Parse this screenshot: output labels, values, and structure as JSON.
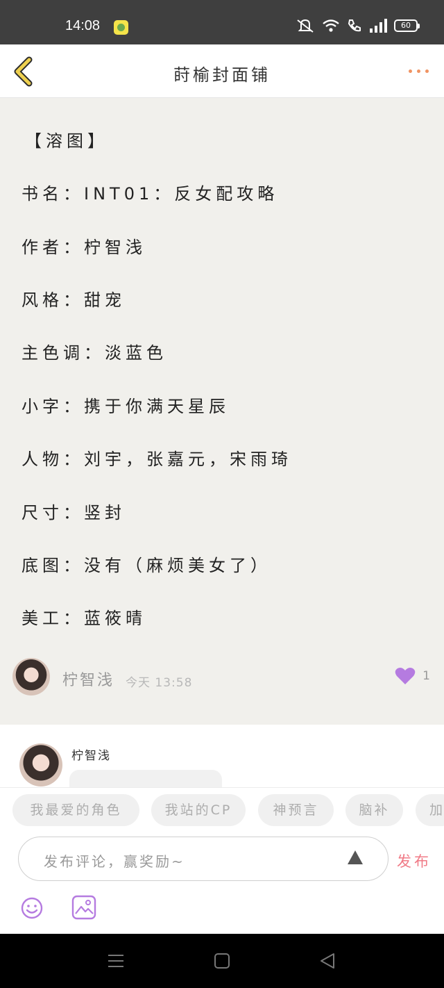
{
  "status_bar": {
    "time": "14:08",
    "battery": "60",
    "icons": [
      "mute-icon",
      "wifi-icon",
      "call-icon",
      "signal-icon",
      "battery-icon"
    ]
  },
  "header": {
    "title": "莳榆封面铺",
    "back_icon": "chevron-left-icon",
    "more_icon": "more-dots-icon",
    "accent_color": "#e8c84a"
  },
  "post": {
    "lines": [
      "【溶图】",
      "书名：INT01：反女配攻略",
      "作者：柠智浅",
      "风格：甜宠",
      "主色调：淡蓝色",
      "小字：携于你满天星辰",
      "人物：刘宇，张嘉元，宋雨琦",
      "尺寸：竖封",
      "底图：没有（麻烦美女了）",
      "美工：蓝筱晴"
    ]
  },
  "author": {
    "name": "柠智浅",
    "time": "今天 13:58",
    "likes": "1",
    "like_color": "#b57be0"
  },
  "comment": {
    "name": "柠智浅"
  },
  "tags": [
    "我最爱的角色",
    "我站的CP",
    "神预言",
    "脑补",
    "加"
  ],
  "input": {
    "placeholder": "发布评论，赢奖励~",
    "publish": "发布",
    "publish_color": "#f07a86"
  }
}
